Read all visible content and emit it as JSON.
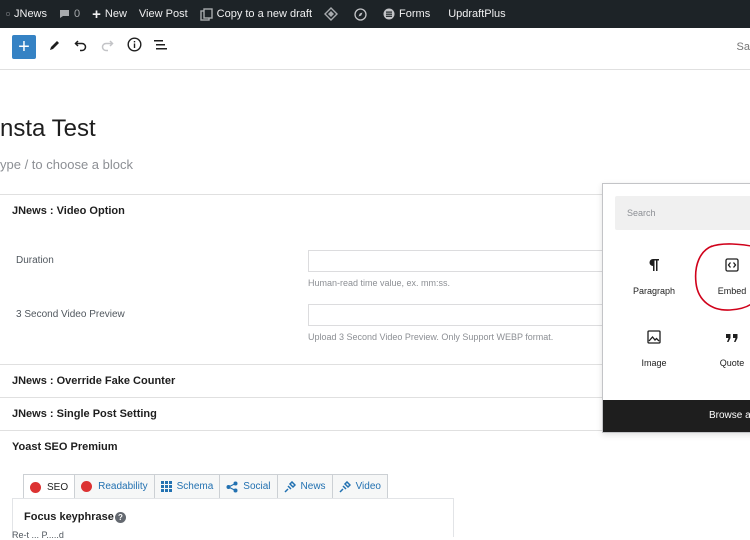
{
  "adminbar": {
    "site_name": "JNews",
    "comments_count": "0",
    "new_label": "New",
    "view_post_label": "View Post",
    "copy_draft_label": "Copy to a new draft",
    "forms_label": "Forms",
    "updraft_label": "UpdraftPlus"
  },
  "toolbar": {
    "add_label": "+",
    "right_label": "Sa"
  },
  "post": {
    "title": "nsta Test",
    "block_hint": "ype / to choose a block"
  },
  "metaboxes": {
    "video_option": {
      "heading": "JNews : Video Option",
      "duration_label": "Duration",
      "duration_help": "Human-read time value, ex. mm:ss.",
      "preview_label": "3 Second Video Preview",
      "preview_help": "Upload 3 Second Video Preview. Only Support WEBP format."
    },
    "fake_counter_heading": "JNews : Override Fake Counter",
    "single_post_heading": "JNews : Single Post Setting",
    "yoast_heading": "Yoast SEO Premium"
  },
  "yoast": {
    "tabs": [
      "SEO",
      "Readability",
      "Schema",
      "Social",
      "News",
      "Video"
    ],
    "focus_label": "Focus keyphrase",
    "help_glyph": "?",
    "cut_text": "Re-t ... P.....d"
  },
  "inserter": {
    "search_placeholder": "Search",
    "blocks": [
      {
        "label": "Paragraph",
        "icon": "paragraph-icon"
      },
      {
        "label": "Embed",
        "icon": "embed-icon"
      },
      {
        "label": "Image",
        "icon": "image-icon"
      },
      {
        "label": "Quote",
        "icon": "quote-icon"
      }
    ],
    "browse_all": "Browse al"
  },
  "colors": {
    "adminbar_bg": "#1d2327",
    "accent": "#3582c4",
    "annotation_red": "#d0021b"
  }
}
